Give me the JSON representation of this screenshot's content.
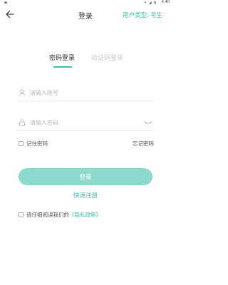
{
  "status_bar": {
    "time": "4:40",
    "icons": [
      "wifi-icon",
      "signal-icon",
      "battery-icon"
    ]
  },
  "header": {
    "title": "登录",
    "user_type_label": "用户类型:",
    "user_type_value": "考生",
    "back_icon": "arrow-left-icon"
  },
  "tabs": [
    {
      "label": "密码登录",
      "active": true
    },
    {
      "label": "验证码登录",
      "active": false
    }
  ],
  "form": {
    "account_placeholder": "请输入账号",
    "password_placeholder": "请输入密码",
    "remember_label": "记住密码",
    "forgot_label": "忘记密码",
    "login_label": "登录",
    "register_label": "快速注册"
  },
  "agreement": {
    "prefix": "请仔细阅读我们的",
    "policy_link": "《隐私政策》"
  },
  "colors": {
    "accent": "#3fbfac",
    "button": "#8ed9ce"
  }
}
